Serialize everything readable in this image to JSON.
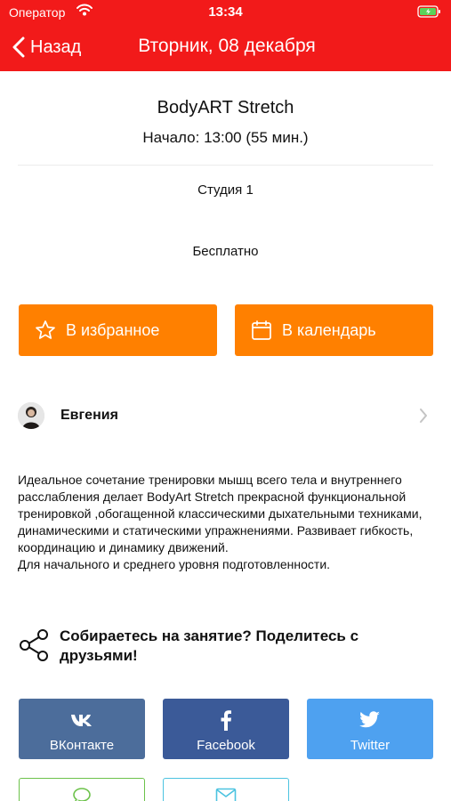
{
  "status_bar": {
    "carrier": "Оператор",
    "time": "13:34"
  },
  "nav": {
    "back_label": "Назад",
    "title": "Вторник, 08 декабря"
  },
  "class": {
    "title": "BodyART Stretch",
    "start": "Начало: 13:00 (55 мин.)",
    "studio": "Студия 1",
    "price": "Бесплатно"
  },
  "actions": {
    "favorite_label": "В избранное",
    "calendar_label": "В календарь"
  },
  "trainer": {
    "name": "Евгения"
  },
  "description": "Идеальное сочетание тренировки мышц всего тела и внутреннего расслабления делает BodyArt Stretch прекрасной функциональной тренировкой ,обогащенной классическими дыхательными техниками, динамическими и статическими упражнениями. Развивает гибкость, координацию и динамику движений.\nДля начального и среднего уровня подготовленности.",
  "share": {
    "prompt": "Собираетесь на занятие? Поделитесь с друзьями!",
    "buttons": [
      {
        "label": "ВКонтакте",
        "icon": "vk-icon",
        "color": "#4c6d9b"
      },
      {
        "label": "Facebook",
        "icon": "facebook-icon",
        "color": "#3b5a98"
      },
      {
        "label": "Twitter",
        "icon": "twitter-icon",
        "color": "#4ea1f0"
      }
    ],
    "more": [
      {
        "icon": "sms-icon",
        "color": "#6cc24a"
      },
      {
        "icon": "mail-icon",
        "color": "#4cc3e0"
      }
    ]
  },
  "colors": {
    "header": "#f21a1a",
    "accent": "#ff8000"
  }
}
